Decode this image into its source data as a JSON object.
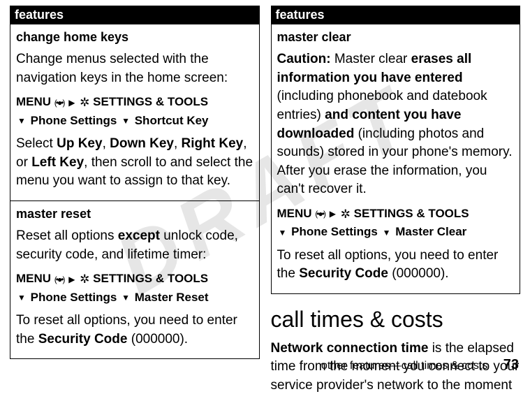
{
  "watermark": "DRAFT",
  "left": {
    "header": "features",
    "changeHome": {
      "title": "change home keys",
      "desc": "Change menus selected with the navigation keys in the home screen:",
      "menuPrefix": "MENU",
      "centerKey": "(•●•)",
      "arrow": "▶",
      "toolsIcon": "✲",
      "settingsTools": " SETTINGS & TOOLS",
      "down": "▼",
      "phoneSettings": " Phone Settings",
      "shortcutKey": " Shortcut Key",
      "selectPrefix": "Select ",
      "upKey": "Up Key",
      "sep1": ", ",
      "downKey": "Down Key",
      "sep2": ", ",
      "rightKey": "Right Key",
      "sep3": ", or ",
      "leftKey": "Left Key",
      "selectSuffix": ", then scroll to and select the menu you want to assign to that key."
    },
    "masterReset": {
      "title": "master reset",
      "descPrefix": "Reset all options ",
      "except": "except",
      "descSuffix": " unlock code, security code, and lifetime timer:",
      "menuPrefix": "MENU",
      "centerKey": "(•●•)",
      "arrow": "▶",
      "toolsIcon": "✲",
      "settingsTools": " SETTINGS & TOOLS",
      "down": "▼",
      "phoneSettings": " Phone Settings",
      "masterReset": " Master Reset",
      "resetPrefix": "To reset all options, you need to enter the ",
      "securityCode": "Security Code",
      "resetSuffix": " (000000)."
    }
  },
  "right": {
    "header": "features",
    "masterClear": {
      "title": "master clear",
      "caution": "Caution:",
      "text1": " Master clear ",
      "erases": "erases all information you have entered",
      "text2": " (including phonebook and datebook entries) ",
      "andContent": "and content you have downloaded",
      "text3": " (including photos and sounds) stored in your phone's memory. After you erase the information, you can't recover it.",
      "menuPrefix": "MENU",
      "centerKey": "(•●•)",
      "arrow": "▶",
      "toolsIcon": "✲",
      "settingsTools": " SETTINGS & TOOLS",
      "down": "▼",
      "phoneSettings": " Phone Settings",
      "masterClear": " Master Clear",
      "resetPrefix": "To reset all options, you need to enter the ",
      "securityCode": "Security Code",
      "resetSuffix": " (000000)."
    },
    "sectionHeading": "call times & costs",
    "sectionBodyPrefix": "Network connection time",
    "sectionBodySuffix": " is the elapsed time from the moment you connect to your service provider's network to the moment"
  },
  "footer": {
    "text": "other features—call times & costs",
    "page": "73"
  }
}
